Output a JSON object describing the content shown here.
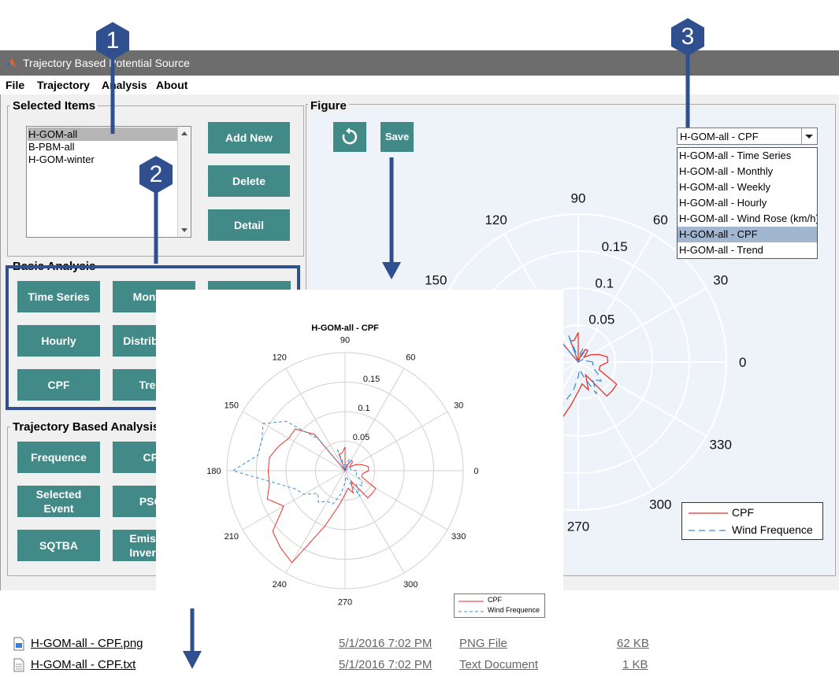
{
  "window": {
    "title": "Trajectory Based Potential Source"
  },
  "menu": [
    "File",
    "Trajectory",
    "Analysis",
    "About"
  ],
  "selected_items": {
    "title": "Selected Items",
    "list": [
      "H-GOM-all",
      "B-PBM-all",
      "H-GOM-winter"
    ],
    "selected_index": 0,
    "buttons": {
      "add": "Add New",
      "delete": "Delete",
      "detail": "Detail"
    }
  },
  "basic_analysis": {
    "title": "Basic Analysis",
    "buttons": [
      "Time Series",
      "Monthly",
      "",
      "Hourly",
      "Distribution",
      "",
      "CPF",
      "Trend",
      ""
    ]
  },
  "trajectory_analysis": {
    "title": "Trajectory Based Analysis",
    "buttons": [
      "Frequence",
      "CPF",
      "Selected Event",
      "PSCF",
      "SQTBA",
      "Emission Inversion"
    ]
  },
  "figure": {
    "title": "Figure",
    "refresh_icon": "refresh-icon",
    "save_label": "Save",
    "dropdown_value": "H-GOM-all - CPF",
    "dropdown_options": [
      "H-GOM-all - Time Series",
      "H-GOM-all - Monthly",
      "H-GOM-all - Weekly",
      "H-GOM-all - Hourly",
      "H-GOM-all - Wind Rose (km/h)",
      "H-GOM-all - CPF",
      "H-GOM-all - Trend"
    ],
    "dropdown_selected": 5,
    "angle_labels": [
      "90",
      "60",
      "30",
      "0",
      "330",
      "300",
      "270",
      "120",
      "150"
    ],
    "radial_labels": [
      "0.15",
      "0.1",
      "0.05"
    ],
    "legend": [
      "CPF",
      "Wind Frequence"
    ]
  },
  "chart_data": {
    "type": "polar-line",
    "title": "H-GOM-all - CPF",
    "theta_ticks": [
      0,
      30,
      60,
      90,
      120,
      150,
      180,
      210,
      240,
      270,
      300,
      330
    ],
    "r_ticks": [
      0.05,
      0.1,
      0.15
    ],
    "rlim": [
      0,
      0.2
    ],
    "theta": [
      0,
      10,
      20,
      30,
      40,
      50,
      60,
      70,
      80,
      90,
      100,
      110,
      120,
      130,
      140,
      150,
      160,
      170,
      180,
      190,
      200,
      210,
      220,
      230,
      240,
      250,
      260,
      270,
      280,
      290,
      300,
      310,
      320,
      330,
      340,
      350
    ],
    "series": [
      {
        "name": "CPF",
        "color": "#e8322c",
        "r": [
          0.04,
          0.04,
          0.03,
          0.02,
          0.01,
          0.02,
          0.02,
          0.01,
          0.0,
          0.04,
          0.03,
          0.03,
          0.0,
          0.08,
          0.11,
          0.11,
          0.12,
          0.13,
          0.13,
          0.13,
          0.14,
          0.12,
          0.16,
          0.17,
          0.18,
          0.1,
          0.06,
          0.04,
          0.03,
          0.04,
          0.02,
          0.06,
          0.06,
          0.06,
          0.03,
          0.03
        ]
      },
      {
        "name": "Wind Frequence",
        "color": "#3d8ed8",
        "r": [
          0.02,
          0.01,
          0.01,
          0.01,
          0.0,
          0.0,
          0.02,
          0.02,
          0.01,
          0.01,
          0.01,
          0.04,
          0.0,
          0.07,
          0.13,
          0.16,
          0.15,
          0.15,
          0.19,
          0.12,
          0.09,
          0.08,
          0.06,
          0.07,
          0.06,
          0.06,
          0.04,
          0.02,
          0.01,
          0.02,
          0.05,
          0.03,
          0.04,
          0.03,
          0.02,
          0.02
        ]
      }
    ],
    "legend": [
      "CPF",
      "Wind Frequence"
    ]
  },
  "files": [
    {
      "name": "H-GOM-all - CPF.png",
      "date": "5/1/2016 7:02 PM",
      "type": "PNG File",
      "size": "62 KB",
      "icon": "image-file-icon"
    },
    {
      "name": "H-GOM-all - CPF.txt",
      "date": "5/1/2016 7:02 PM",
      "type": "Text Document",
      "size": "1 KB",
      "icon": "text-file-icon"
    }
  ],
  "callouts": [
    "1",
    "2",
    "3"
  ],
  "accent": "#418a88",
  "callout_color": "#2f4f8f"
}
